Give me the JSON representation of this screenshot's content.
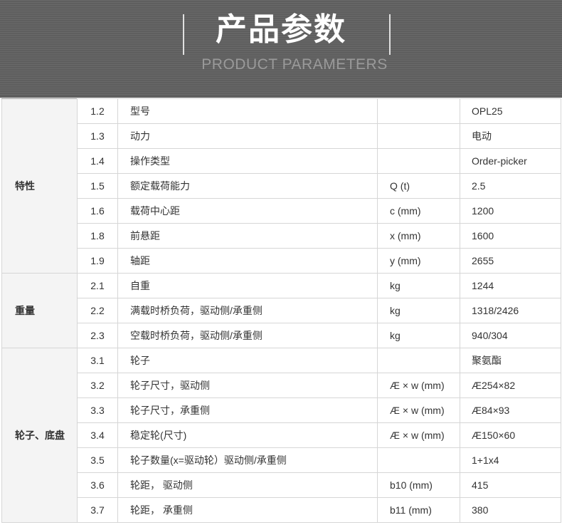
{
  "header": {
    "title": "产品参数",
    "subtitle": "PRODUCT PARAMETERS"
  },
  "colors": {
    "banner_bg": "#5e5e5e",
    "group_bg": "#f4f4f4",
    "border": "#d6d6d6"
  },
  "groups": [
    {
      "name": "特性",
      "rows": [
        {
          "num": "1.2",
          "name": "型号",
          "unit": "",
          "value": "OPL25"
        },
        {
          "num": "1.3",
          "name": "动力",
          "unit": "",
          "value": "电动"
        },
        {
          "num": "1.4",
          "name": "操作类型",
          "unit": "",
          "value": "Order-picker"
        },
        {
          "num": "1.5",
          "name": "额定载荷能力",
          "unit": "Q (t)",
          "value": "2.5"
        },
        {
          "num": "1.6",
          "name": "载荷中心距",
          "unit": "c (mm)",
          "value": "1200"
        },
        {
          "num": "1.8",
          "name": "前悬距",
          "unit": "x (mm)",
          "value": "1600"
        },
        {
          "num": "1.9",
          "name": "轴距",
          "unit": "y (mm)",
          "value": "2655"
        }
      ]
    },
    {
      "name": "重量",
      "rows": [
        {
          "num": "2.1",
          "name": "自重",
          "unit": "kg",
          "value": "1244"
        },
        {
          "num": "2.2",
          "name": "满载时桥负荷，驱动侧/承重侧",
          "unit": "kg",
          "value": "1318/2426"
        },
        {
          "num": "2.3",
          "name": "空载时桥负荷，驱动侧/承重侧",
          "unit": "kg",
          "value": "940/304"
        }
      ]
    },
    {
      "name": "轮子、底盘",
      "rows": [
        {
          "num": "3.1",
          "name": "轮子",
          "unit": "",
          "value": "聚氨酯"
        },
        {
          "num": "3.2",
          "name": "轮子尺寸，驱动侧",
          "unit": "Æ × w (mm)",
          "value": "Æ254×82"
        },
        {
          "num": "3.3",
          "name": "轮子尺寸，承重侧",
          "unit": "Æ × w (mm)",
          "value": "Æ84×93"
        },
        {
          "num": "3.4",
          "name": "稳定轮(尺寸)",
          "unit": "Æ × w (mm)",
          "value": "Æ150×60"
        },
        {
          "num": "3.5",
          "name": "轮子数量(x=驱动轮）驱动侧/承重侧",
          "unit": "",
          "value": "1+1x4"
        },
        {
          "num": "3.6",
          "name": "轮距， 驱动侧",
          "unit": "b10 (mm)",
          "value": "415"
        },
        {
          "num": "3.7",
          "name": "轮距， 承重侧",
          "unit": "b11 (mm)",
          "value": "380"
        }
      ]
    }
  ]
}
